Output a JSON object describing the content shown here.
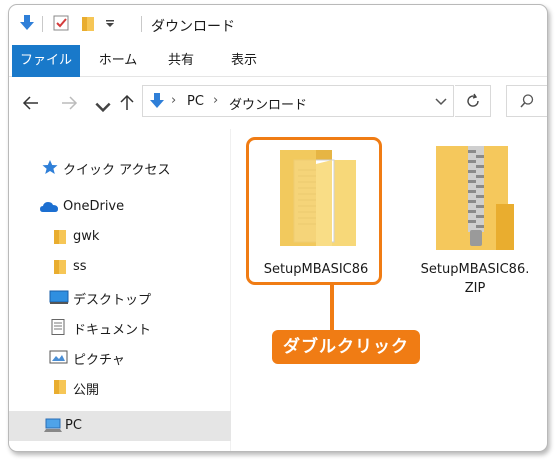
{
  "titlebar": {
    "title": "ダウンロード",
    "icons": [
      "down-arrow-icon",
      "checkbox-icon",
      "folder-icon",
      "dropdown-icon"
    ]
  },
  "ribbon": {
    "tabs": [
      {
        "label": "ファイル",
        "active": true
      },
      {
        "label": "ホーム",
        "active": false
      },
      {
        "label": "共有",
        "active": false
      },
      {
        "label": "表示",
        "active": false
      }
    ]
  },
  "address": {
    "back_icon": "back-arrow-icon",
    "forward_icon": "forward-arrow-icon",
    "recent_icon": "chevron-down-icon",
    "up_icon": "up-arrow-icon",
    "crumbs": [
      "PC",
      "ダウンロード"
    ],
    "refresh_icon": "refresh-icon",
    "search_icon": "search-icon"
  },
  "nav": {
    "quick_access": "クイック アクセス",
    "onedrive": "OneDrive",
    "gwk": "gwk",
    "ss": "ss",
    "desktop": "デスクトップ",
    "documents": "ドキュメント",
    "pictures": "ピクチャ",
    "public": "公開",
    "pc": "PC"
  },
  "files": [
    {
      "name": "SetupMBASIC86",
      "type": "folder",
      "highlighted": true
    },
    {
      "name": "SetupMBASIC86.ZIP",
      "type": "zip",
      "highlighted": false
    }
  ],
  "callout": {
    "text": "ダブルクリック",
    "color": "#f07c14"
  },
  "colors": {
    "accent": "#1979ca",
    "highlight": "#f07c14",
    "selected_bg": "#e5e5e5"
  }
}
